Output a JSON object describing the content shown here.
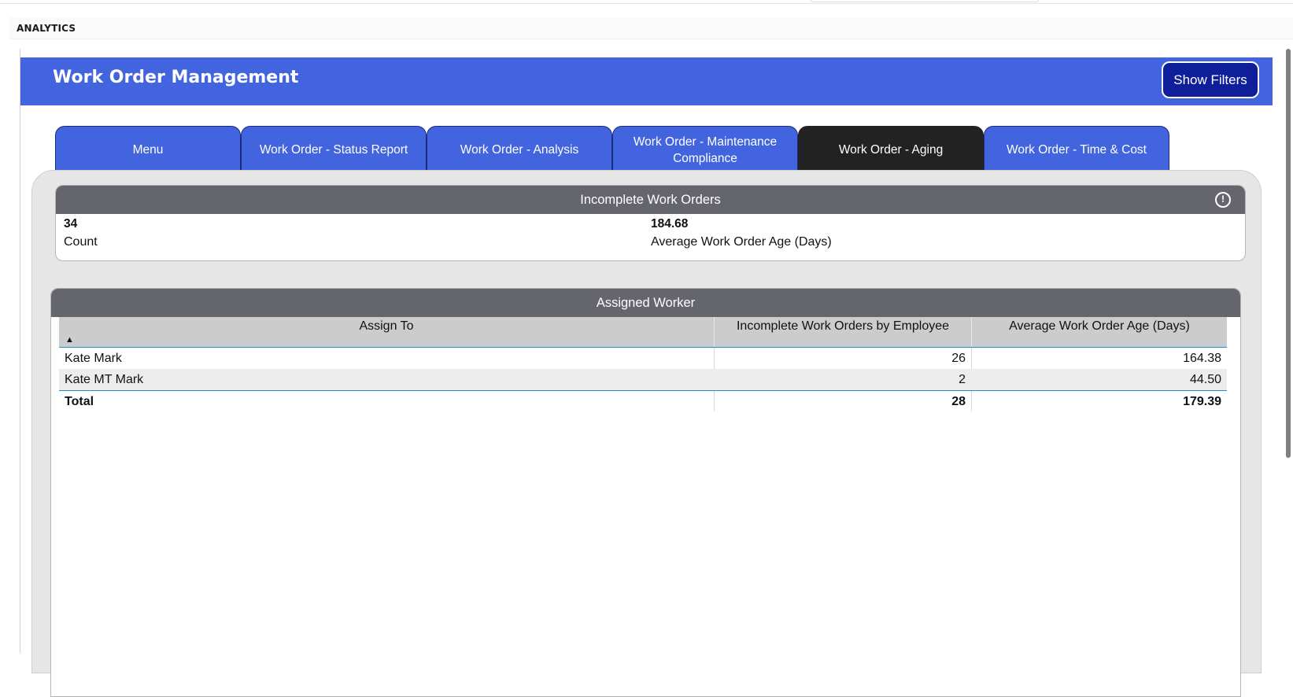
{
  "app": {
    "label": "ANALYTICS"
  },
  "header": {
    "title": "Work Order Management",
    "filters_button": "Show Filters"
  },
  "tabs": [
    {
      "label": "Menu",
      "active": false
    },
    {
      "label": "Work Order - Status Report",
      "active": false
    },
    {
      "label": "Work Order - Analysis",
      "active": false
    },
    {
      "label": "Work Order - Maintenance Compliance",
      "active": false
    },
    {
      "label": "Work Order - Aging",
      "active": true
    },
    {
      "label": "Work Order - Time & Cost",
      "active": false
    }
  ],
  "incomplete": {
    "title": "Incomplete Work Orders",
    "info_icon": "info-icon",
    "count": {
      "value": "34",
      "label": "Count"
    },
    "average_age": {
      "value": "184.68",
      "label": "Average Work Order Age (Days)"
    }
  },
  "assigned_worker": {
    "title": "Assigned Worker",
    "columns": [
      "Assign To",
      "Incomplete Work Orders by Employee",
      "Average Work Order Age (Days)"
    ],
    "sort_icon": "sort-ascending-icon",
    "rows": [
      {
        "name": "Kate Mark",
        "count": "26",
        "age": "164.38"
      },
      {
        "name": "Kate MT Mark",
        "count": "2",
        "age": "44.50"
      }
    ],
    "total": {
      "label": "Total",
      "count": "28",
      "age": "179.39"
    }
  },
  "colors": {
    "primary": "#4265df",
    "button_dark": "#0f1f9a",
    "active_tab": "#222222",
    "card_header": "#65656d"
  }
}
